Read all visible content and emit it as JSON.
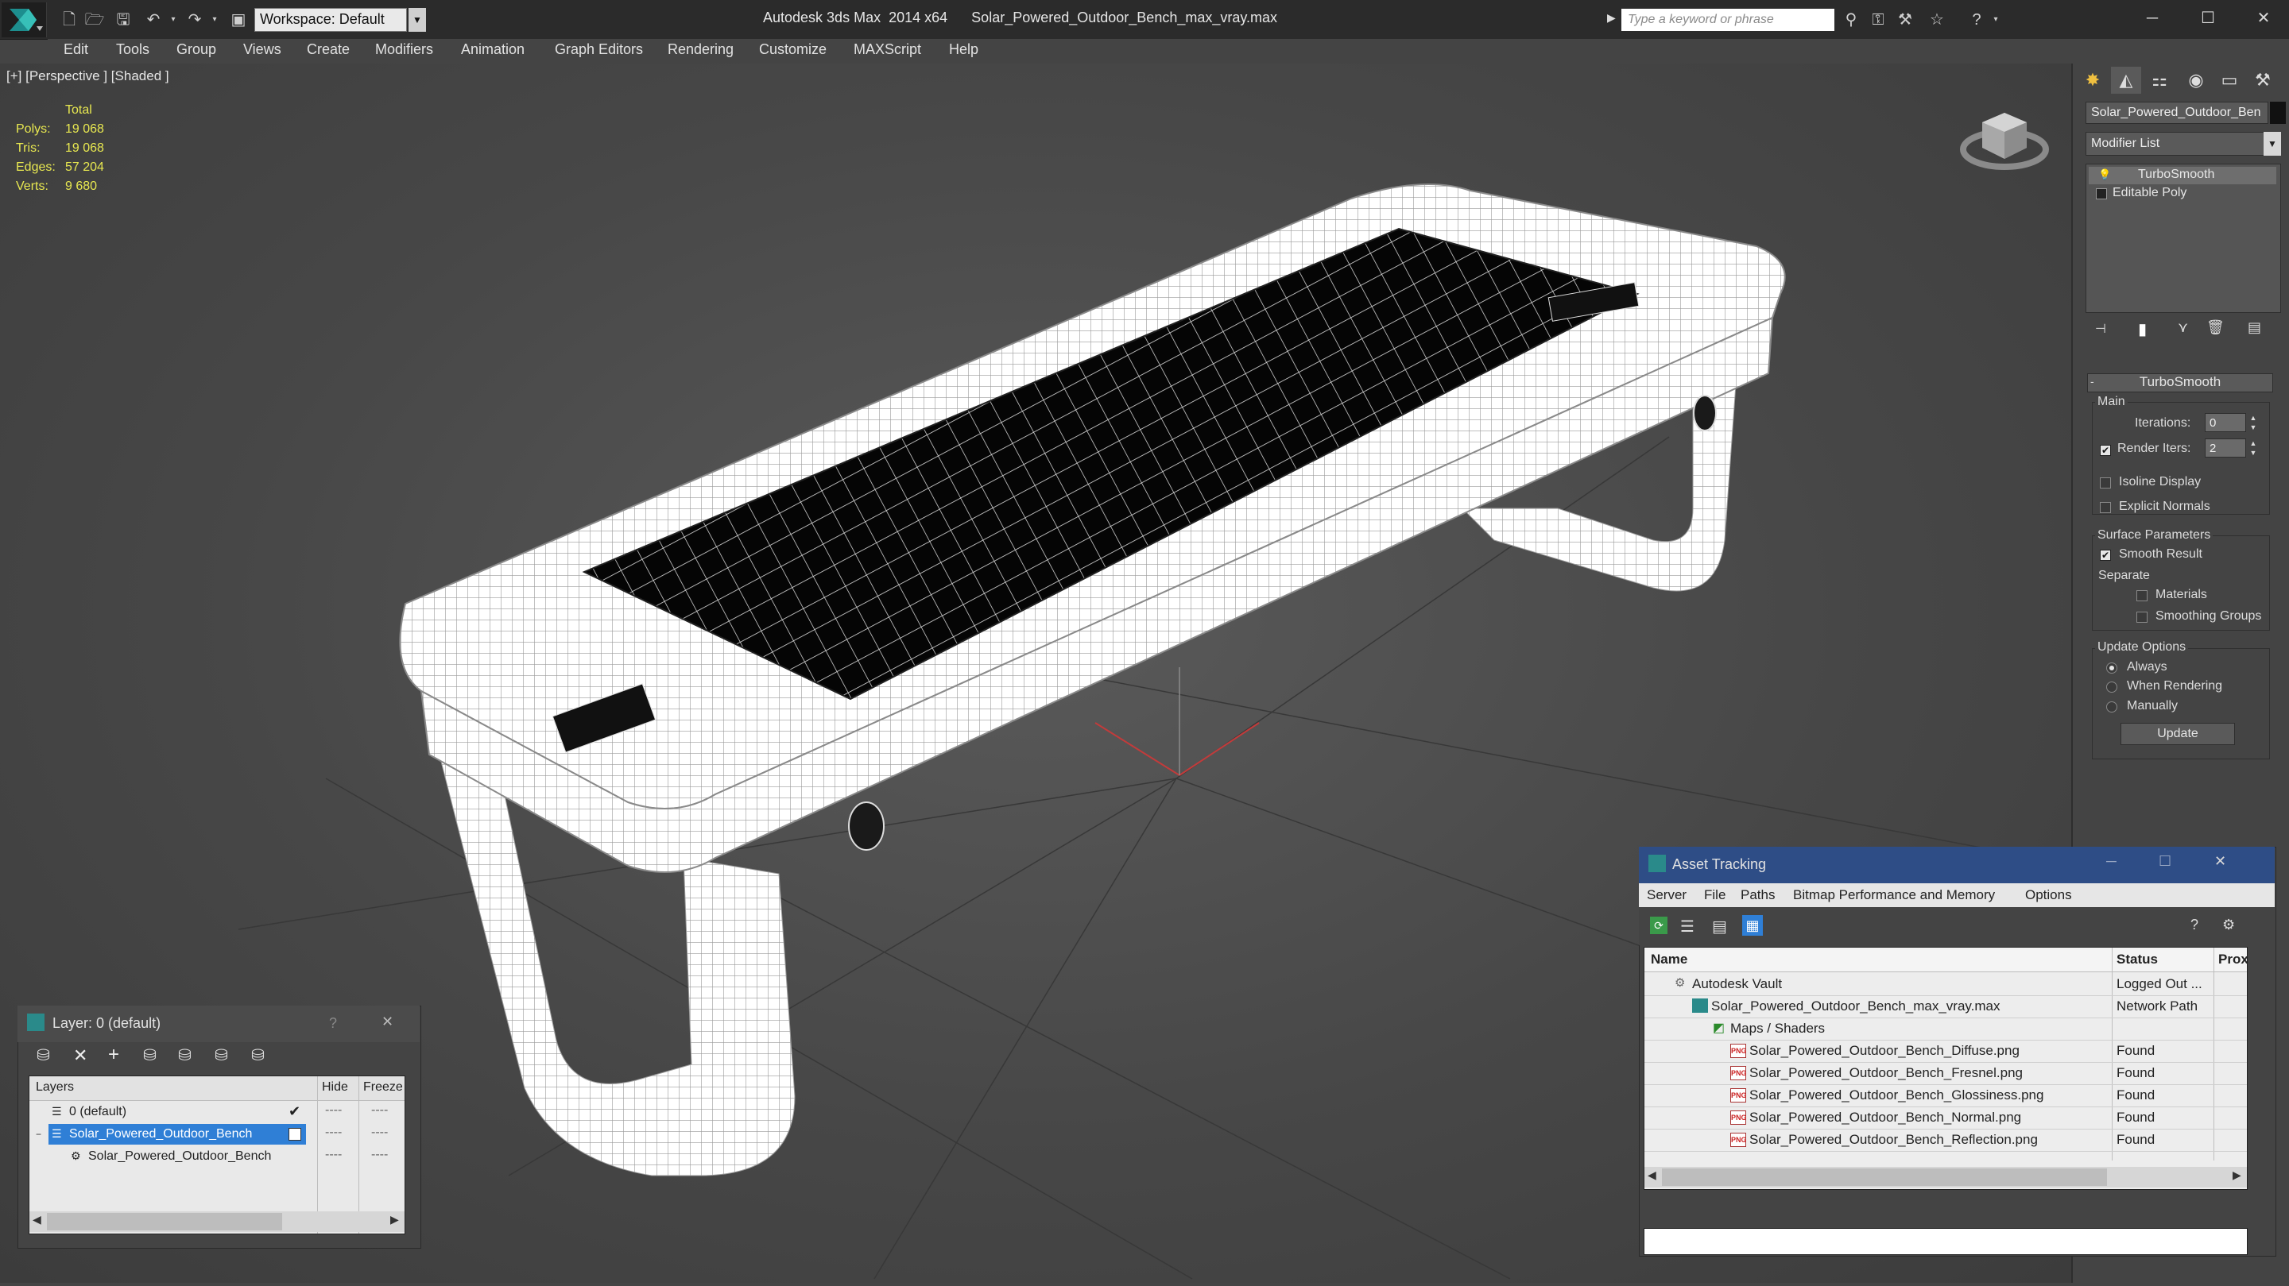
{
  "titlebar": {
    "workspace_label": "Workspace: Default",
    "app_title": "Autodesk 3ds Max  2014 x64",
    "file_title": "Solar_Powered_Outdoor_Bench_max_vray.max",
    "search_placeholder": "Type a keyword or phrase"
  },
  "menubar": {
    "items": [
      "Edit",
      "Tools",
      "Group",
      "Views",
      "Create",
      "Modifiers",
      "Animation",
      "Graph Editors",
      "Rendering",
      "Customize",
      "MAXScript",
      "Help"
    ]
  },
  "viewport": {
    "label": "[+] [Perspective ] [Shaded ]",
    "stats": {
      "total_label": "Total",
      "polys_label": "Polys:",
      "polys": "19 068",
      "tris_label": "Tris:",
      "tris": "19 068",
      "edges_label": "Edges:",
      "edges": "57 204",
      "verts_label": "Verts:",
      "verts": "9 680"
    },
    "gizmo_colors": {
      "x": "#c23b3b",
      "y": "#c23b3b",
      "z": "#8a8a8a"
    }
  },
  "command_panel": {
    "object_name": "Solar_Powered_Outdoor_Ben",
    "modifier_list": "Modifier List",
    "stack": [
      "TurboSmooth",
      "Editable Poly"
    ],
    "turbosmooth": {
      "header": "TurboSmooth",
      "main_label": "Main",
      "iterations_label": "Iterations:",
      "iterations": "0",
      "render_iters_label": "Render Iters:",
      "render_iters": "2",
      "isoline_label": "Isoline Display",
      "explicit_label": "Explicit Normals",
      "surface_label": "Surface Parameters",
      "smooth_label": "Smooth Result",
      "separate_label": "Separate",
      "materials_label": "Materials",
      "smoothing_groups_label": "Smoothing Groups",
      "update_options_label": "Update Options",
      "always_label": "Always",
      "when_rendering_label": "When Rendering",
      "manually_label": "Manually",
      "update_button": "Update"
    }
  },
  "layer_dialog": {
    "title": "Layer: 0 (default)",
    "help": "?",
    "col_layers": "Layers",
    "col_hide": "Hide",
    "col_freeze": "Freeze",
    "rows": [
      {
        "name": "0 (default)"
      },
      {
        "name": "Solar_Powered_Outdoor_Bench"
      },
      {
        "name": "Solar_Powered_Outdoor_Bench"
      }
    ],
    "dash": "----"
  },
  "asset_tracking": {
    "title": "Asset Tracking",
    "menu": [
      "Server",
      "File",
      "Paths",
      "Bitmap Performance and Memory",
      "Options"
    ],
    "col_name": "Name",
    "col_status": "Status",
    "col_proxy": "Prox",
    "rows": [
      {
        "name": "Autodesk Vault",
        "status": "Logged Out ..."
      },
      {
        "name": "Solar_Powered_Outdoor_Bench_max_vray.max",
        "status": "Network Path"
      },
      {
        "name": "Maps / Shaders",
        "status": ""
      },
      {
        "name": "Solar_Powered_Outdoor_Bench_Diffuse.png",
        "status": "Found"
      },
      {
        "name": "Solar_Powered_Outdoor_Bench_Fresnel.png",
        "status": "Found"
      },
      {
        "name": "Solar_Powered_Outdoor_Bench_Glossiness.png",
        "status": "Found"
      },
      {
        "name": "Solar_Powered_Outdoor_Bench_Normal.png",
        "status": "Found"
      },
      {
        "name": "Solar_Powered_Outdoor_Bench_Reflection.png",
        "status": "Found"
      }
    ]
  },
  "colors": {
    "accent": "#2e4d86",
    "selection": "#2f7fd6",
    "stats": "#e8e850"
  }
}
